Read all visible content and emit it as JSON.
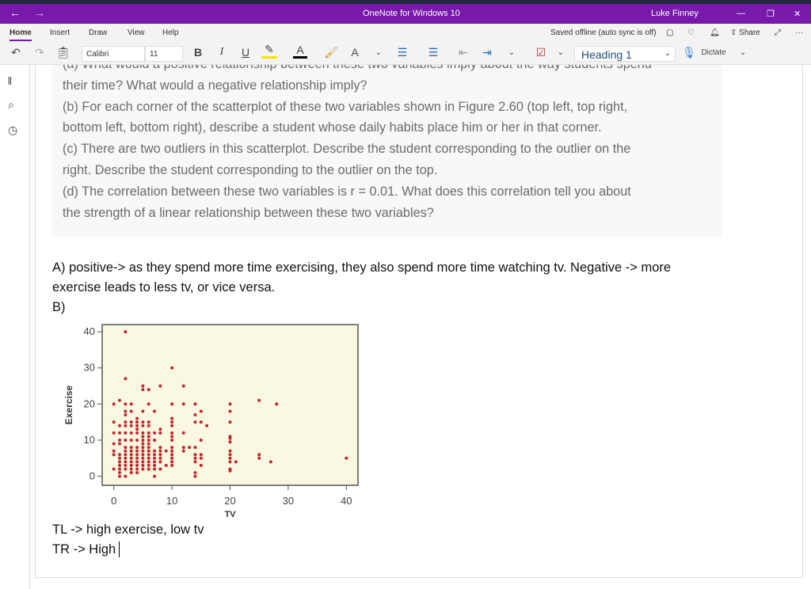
{
  "window": {
    "title": "OneNote for Windows 10",
    "user": "Luke Finney",
    "status": "Saved offline (auto sync is off)",
    "share": "Share"
  },
  "ribbon": {
    "tabs": [
      "Home",
      "Insert",
      "Draw",
      "View",
      "Help"
    ],
    "font": "Calibri",
    "size": "11",
    "bold": "B",
    "italic": "I",
    "underline": "U",
    "style": "Heading 1",
    "dictate": "Dictate"
  },
  "colors": {
    "brand": "#7719aa",
    "points": "#c1272d",
    "plot_bg": "#fbf8e2"
  },
  "question": {
    "lines": [
      "(a) What would a positive relationship between these two variables imply about the way students spend",
      "their time? What would a negative relationship imply?",
      "(b) For each corner of the scatterplot of these two variables shown in Figure 2.60 (top left, top right,",
      "bottom left, bottom right), describe a student whose daily habits place him or her in that corner.",
      "(c) There are two outliers in this scatterplot. Describe the student corresponding to the outlier on the",
      "right. Describe the student corresponding to the outlier on the top.",
      "(d) The correlation between these two variables is r = 0.01. What does this correlation tell you about",
      "the strength of a linear relationship between these two variables?"
    ]
  },
  "answers": {
    "a1": "A) positive-> as they spend more time exercising, they also spend more time watching tv. Negative -> more",
    "a2": "exercise leads to less tv, or vice versa.",
    "b": "B)",
    "tl": "TL -> high exercise, low tv",
    "tr": "TR -> High"
  },
  "chart_data": {
    "type": "scatter",
    "xlabel": "TV",
    "ylabel": "Exercise",
    "xlim": [
      -2,
      42
    ],
    "ylim": [
      -2.5,
      42
    ],
    "xticks": [
      0,
      10,
      20,
      30,
      40
    ],
    "yticks": [
      0,
      10,
      20,
      30,
      40
    ],
    "grid": false,
    "points_by_x": {
      "0": [
        2,
        6,
        7,
        9,
        12,
        15,
        20
      ],
      "1": [
        0,
        1,
        2,
        3,
        4,
        5,
        6,
        9,
        10,
        12,
        14,
        21
      ],
      "2": [
        0,
        2,
        3,
        4,
        5,
        6,
        7,
        8,
        10,
        12,
        14,
        15,
        17,
        18,
        20,
        27,
        40
      ],
      "3": [
        1,
        2,
        3,
        4,
        5,
        6,
        7,
        8,
        10,
        12,
        14,
        15,
        18,
        20
      ],
      "4": [
        1,
        2,
        3,
        4,
        5,
        6,
        7,
        8,
        10,
        12,
        13,
        14,
        15,
        16
      ],
      "5": [
        2,
        3,
        4,
        5,
        6,
        7,
        8,
        9,
        10,
        11,
        12,
        14,
        15,
        18,
        24,
        25
      ],
      "6": [
        2,
        3,
        4,
        5,
        6,
        7,
        8,
        9,
        10,
        11,
        12,
        14,
        15,
        20,
        24
      ],
      "7": [
        0,
        2,
        3,
        4,
        5,
        6,
        7,
        10,
        12,
        18
      ],
      "8": [
        2,
        4,
        5,
        6,
        7,
        8,
        12,
        13,
        25
      ],
      "9": [
        3,
        7
      ],
      "10": [
        3,
        4,
        5,
        6,
        7,
        8,
        10,
        11,
        12,
        14,
        15,
        16,
        20,
        30
      ],
      "12": [
        7,
        8,
        12,
        20,
        25
      ],
      "13": [
        8
      ],
      "14": [
        0,
        1,
        4,
        5,
        6,
        8,
        15,
        17,
        20
      ],
      "15": [
        3,
        5,
        6,
        10,
        15,
        18
      ],
      "16": [
        14
      ],
      "20": [
        1.5,
        2,
        4,
        5,
        6,
        7,
        9.5,
        10.5,
        11,
        15,
        18,
        20
      ],
      "21": [
        4
      ],
      "25": [
        5,
        6,
        21
      ],
      "27": [
        4
      ],
      "28": [
        20
      ],
      "40": [
        5
      ]
    }
  }
}
